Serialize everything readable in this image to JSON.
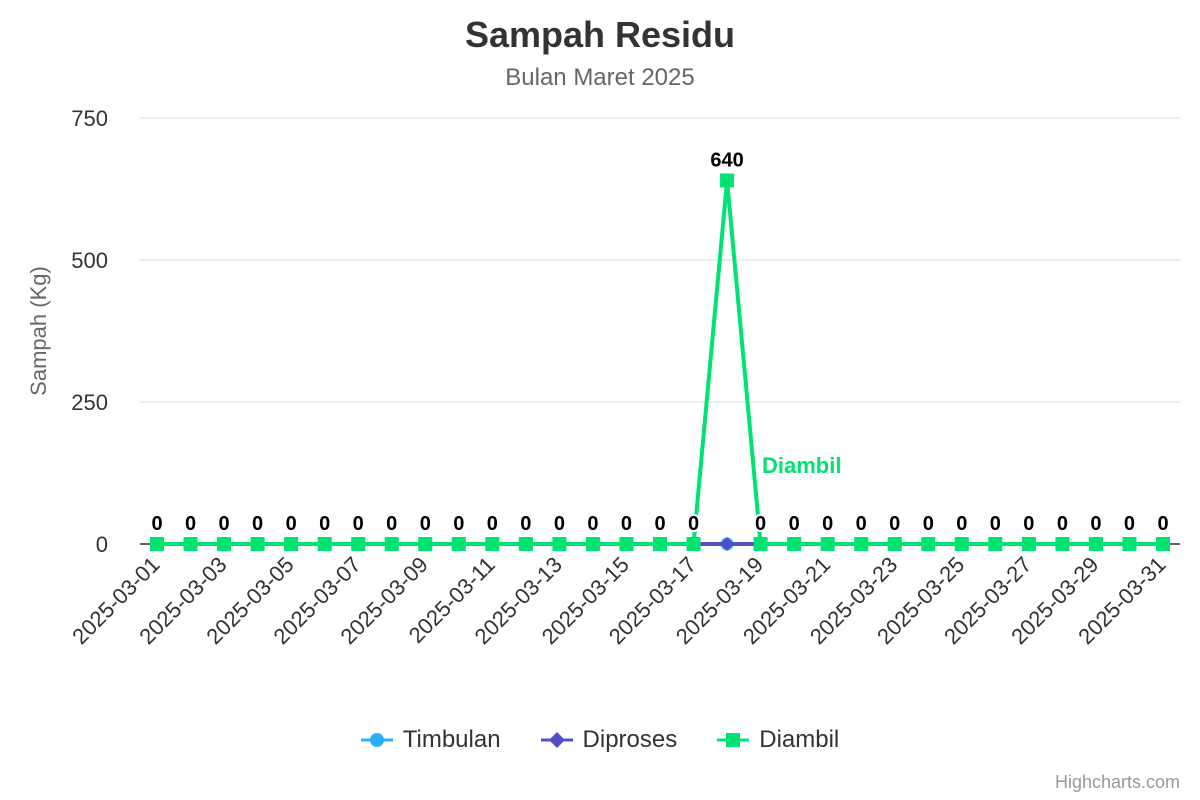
{
  "chart_data": {
    "type": "line",
    "title": "Sampah Residu",
    "subtitle": "Bulan Maret 2025",
    "ylabel": "Sampah (Kg)",
    "xlabel": "",
    "ylim": [
      0,
      750
    ],
    "yticks": [
      0,
      250,
      500,
      750
    ],
    "grid": true,
    "legend_position": "bottom",
    "x": [
      "2025-03-01",
      "2025-03-02",
      "2025-03-03",
      "2025-03-04",
      "2025-03-05",
      "2025-03-06",
      "2025-03-07",
      "2025-03-08",
      "2025-03-09",
      "2025-03-10",
      "2025-03-11",
      "2025-03-12",
      "2025-03-13",
      "2025-03-14",
      "2025-03-15",
      "2025-03-16",
      "2025-03-17",
      "2025-03-18",
      "2025-03-19",
      "2025-03-20",
      "2025-03-21",
      "2025-03-22",
      "2025-03-23",
      "2025-03-24",
      "2025-03-25",
      "2025-03-26",
      "2025-03-27",
      "2025-03-28",
      "2025-03-29",
      "2025-03-30",
      "2025-03-31"
    ],
    "xtick_labels": [
      "2025-03-01",
      "2025-03-03",
      "2025-03-05",
      "2025-03-07",
      "2025-03-09",
      "2025-03-11",
      "2025-03-13",
      "2025-03-15",
      "2025-03-17",
      "2025-03-19",
      "2025-03-21",
      "2025-03-23",
      "2025-03-25",
      "2025-03-27",
      "2025-03-29",
      "2025-03-31"
    ],
    "series": [
      {
        "name": "Timbulan",
        "color": "#2caffe",
        "marker": "circle",
        "values": [
          null,
          null,
          null,
          null,
          null,
          null,
          null,
          null,
          null,
          null,
          null,
          null,
          null,
          null,
          null,
          null,
          null,
          0,
          null,
          null,
          null,
          null,
          null,
          null,
          null,
          null,
          null,
          null,
          null,
          null,
          null
        ]
      },
      {
        "name": "Diproses",
        "color": "#544fc5",
        "marker": "diamond",
        "values": [
          0,
          0,
          0,
          0,
          0,
          0,
          0,
          0,
          0,
          0,
          0,
          0,
          0,
          0,
          0,
          0,
          0,
          0,
          0,
          0,
          0,
          0,
          0,
          0,
          0,
          0,
          0,
          0,
          0,
          0,
          0
        ]
      },
      {
        "name": "Diambil",
        "color": "#00e272",
        "marker": "square",
        "values": [
          0,
          0,
          0,
          0,
          0,
          0,
          0,
          0,
          0,
          0,
          0,
          0,
          0,
          0,
          0,
          0,
          0,
          640,
          0,
          0,
          0,
          0,
          0,
          0,
          0,
          0,
          0,
          0,
          0,
          0,
          0
        ],
        "annotation": "Diambil"
      }
    ]
  },
  "credits": "Highcharts.com"
}
